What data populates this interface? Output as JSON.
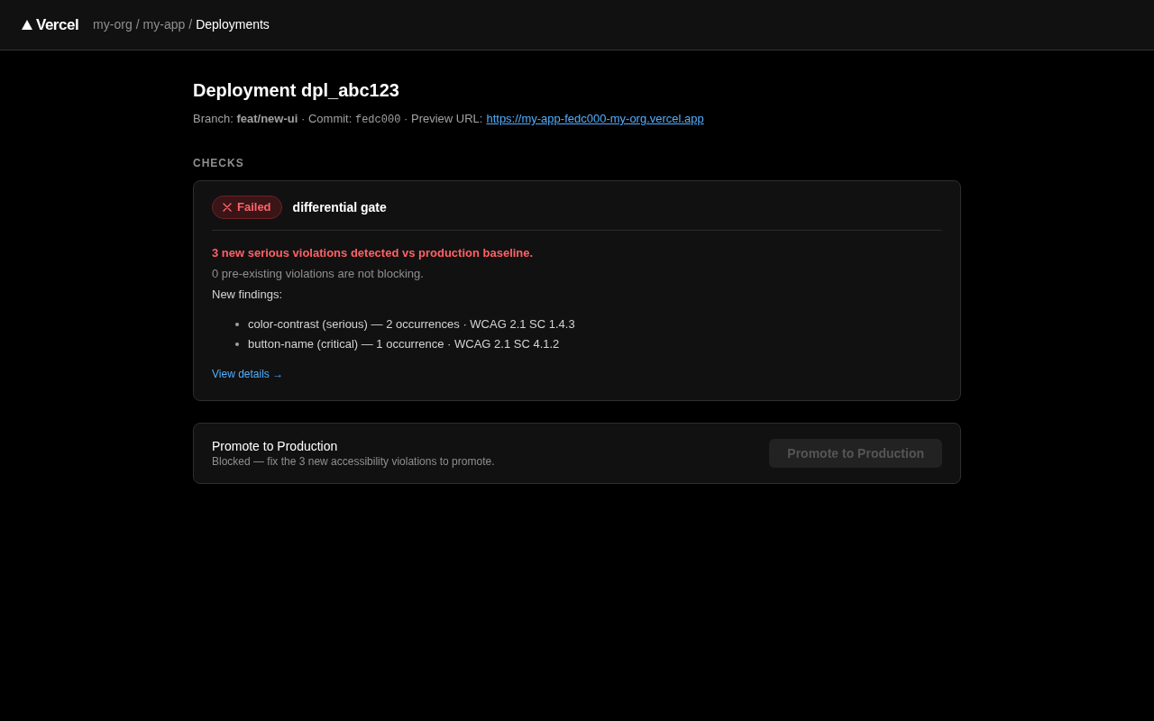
{
  "header": {
    "logo": {
      "text": "Vercel"
    },
    "breadcrumb": [
      {
        "kind": "crumb",
        "label": "my-org",
        "selected": false
      },
      {
        "kind": "separator",
        "label": "/"
      },
      {
        "kind": "crumb",
        "label": "my-app",
        "selected": false
      },
      {
        "kind": "separator",
        "label": "/"
      },
      {
        "kind": "crumb",
        "label": "Deployments",
        "selected": true
      }
    ]
  },
  "deployment": {
    "title": "Deployment dpl_abc123",
    "meta": [
      {
        "kind": "label",
        "text": "Branch:"
      },
      {
        "kind": "strong",
        "text": "feat/new-ui"
      },
      {
        "kind": "separator",
        "text": "·"
      },
      {
        "kind": "label",
        "text": "Commit:"
      },
      {
        "kind": "code",
        "text": "fedc000"
      },
      {
        "kind": "separator",
        "text": "·"
      },
      {
        "kind": "label",
        "text": "Preview URL:"
      }
    ],
    "preview_link": "https://my-app-fedc000-my-org.vercel.app"
  },
  "checks": {
    "heading": "CHECKS",
    "items": [
      {
        "status": {
          "kind": "failed",
          "label": "Failed"
        },
        "name": "differential gate",
        "summary": "3 new serious violations detected vs production baseline.",
        "note": "0 pre-existing violations are not blocking.",
        "findings_label": "New findings:",
        "findings": [
          "color-contrast (serious) — 2 occurrences · WCAG 2.1 SC 1.4.3",
          "button-name (critical) — 1 occurrence · WCAG 2.1 SC 4.1.2"
        ],
        "details_link": "View details →"
      }
    ]
  },
  "promote": {
    "title": "Promote to Production",
    "description": "Blocked — fix the 3 new accessibility violations to promote.",
    "button": {
      "label": "Promote to Production",
      "disabled": true
    }
  }
}
